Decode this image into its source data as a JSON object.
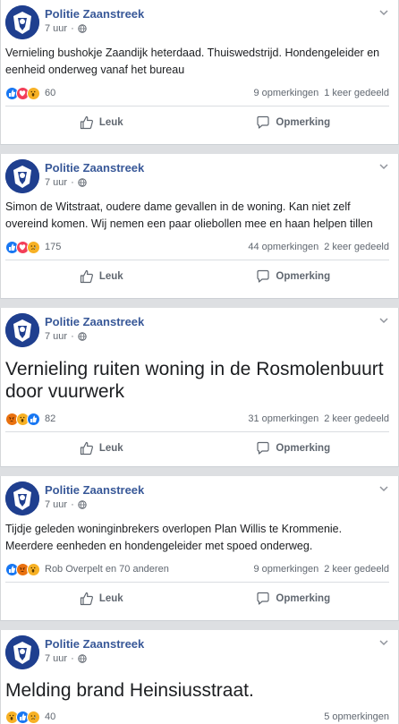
{
  "common": {
    "like_label": "Leuk",
    "comment_label": "Opmerking"
  },
  "posts": [
    {
      "page": "Politie Zaanstreek",
      "time": "7 uur",
      "text": "Vernieling bushokje Zaandijk heterdaad. Thuiswedstrijd. Hondengeleider en eenheid onderweg vanaf het bureau",
      "reactions": [
        "like",
        "love",
        "wow"
      ],
      "reaction_count": "60",
      "comments": "9 opmerkingen",
      "shares": "1 keer gedeeld"
    },
    {
      "page": "Politie Zaanstreek",
      "time": "7 uur",
      "text": "Simon de Witstraat, oudere dame gevallen in de woning. Kan niet zelf overeind komen. Wij nemen een paar oliebollen mee en haan helpen tillen",
      "reactions": [
        "like",
        "love",
        "sad"
      ],
      "reaction_count": "175",
      "comments": "44 opmerkingen",
      "shares": "2 keer gedeeld"
    },
    {
      "page": "Politie Zaanstreek",
      "time": "7 uur",
      "text": "Vernieling ruiten woning in de Rosmolenbuurt door vuurwerk",
      "reactions": [
        "angry",
        "wow",
        "like"
      ],
      "reaction_count": "82",
      "comments": "31 opmerkingen",
      "shares": "2 keer gedeeld"
    },
    {
      "page": "Politie Zaanstreek",
      "time": "7 uur",
      "text": "Tijdje geleden woninginbrekers overlopen Plan Willis te Krommenie. Meerdere eenheden en hondengeleider met spoed onderweg.",
      "reactions": [
        "like",
        "angry",
        "wow"
      ],
      "reaction_count": "Rob Overpelt en 70 anderen",
      "comments": "9 opmerkingen",
      "shares": "2 keer gedeeld"
    },
    {
      "page": "Politie Zaanstreek",
      "time": "7 uur",
      "text": "Melding brand Heinsiusstraat.",
      "reactions": [
        "wow",
        "like",
        "sad"
      ],
      "reaction_count": "40",
      "comments": "5 opmerkingen",
      "shares": ""
    }
  ],
  "colors": {
    "page_name": "#385898",
    "avatar_bg": "#1f3f8f",
    "like": "#1877f2",
    "love": "#f33e58",
    "wow": "#f7b125",
    "angry": "#e9710f"
  }
}
